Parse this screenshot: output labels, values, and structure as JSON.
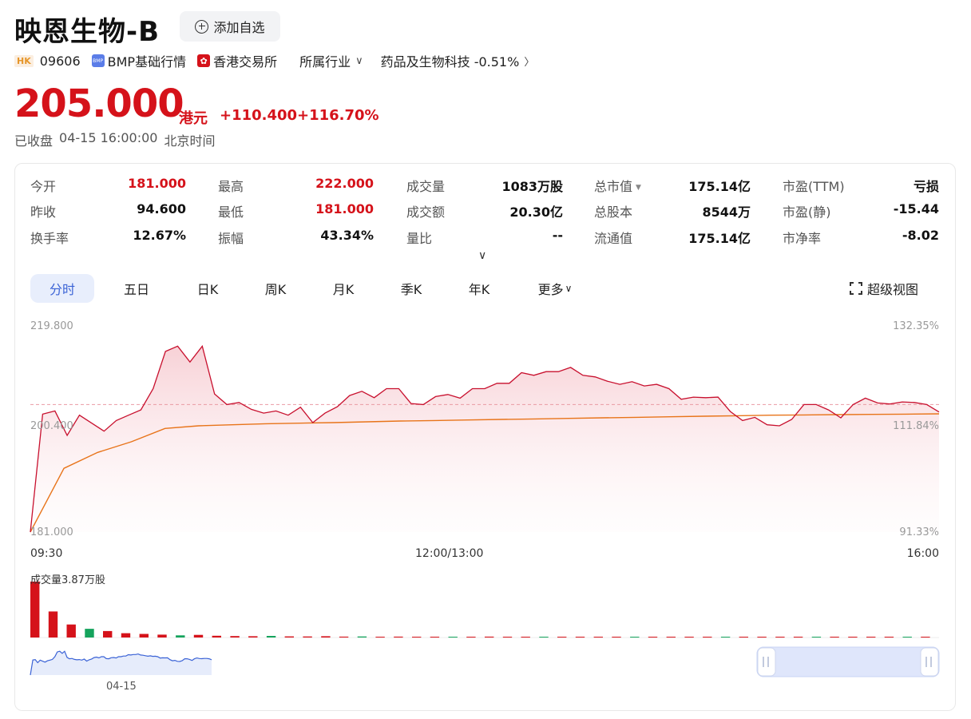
{
  "stock": {
    "name": "映恩生物-B",
    "watch_label": "添加自选",
    "market_badge": "HK",
    "code": "09606",
    "bmp_badge": "BMP",
    "bmp_label": "BMP基础行情",
    "exchange_label": "香港交易所",
    "industry_label": "所属行业",
    "sector_label": "药品及生物科技 -0.51%"
  },
  "quote": {
    "price": "205.000",
    "currency": "港元",
    "change": "+110.400",
    "change_pct": "+116.70%",
    "status": "已收盘",
    "time": "04-15 16:00:00",
    "tz": "北京时间"
  },
  "stats": [
    [
      {
        "label": "今开",
        "value": "181.000",
        "red": true
      },
      {
        "label": "最高",
        "value": "222.000",
        "red": true
      },
      {
        "label": "成交量",
        "value": "1083万股"
      },
      {
        "label": "总市值",
        "value": "175.14亿",
        "caret": true
      },
      {
        "label": "市盈(TTM)",
        "value": "亏损"
      }
    ],
    [
      {
        "label": "昨收",
        "value": "94.600"
      },
      {
        "label": "最低",
        "value": "181.000",
        "red": true
      },
      {
        "label": "成交额",
        "value": "20.30亿"
      },
      {
        "label": "总股本",
        "value": "8544万"
      },
      {
        "label": "市盈(静)",
        "value": "-15.44"
      }
    ],
    [
      {
        "label": "换手率",
        "value": "12.67%"
      },
      {
        "label": "振幅",
        "value": "43.34%"
      },
      {
        "label": "量比",
        "value": "--"
      },
      {
        "label": "流通值",
        "value": "175.14亿"
      },
      {
        "label": "市净率",
        "value": "-8.02"
      }
    ]
  ],
  "tabs": [
    "分时",
    "五日",
    "日K",
    "周K",
    "月K",
    "季K",
    "年K",
    "更多"
  ],
  "superview_label": "超级视图",
  "chart_data": {
    "type": "line",
    "series": [
      {
        "name": "price",
        "values": [
          181.0,
          203.2,
          203.8,
          199.2,
          203.0,
          201.5,
          200.0,
          202.0,
          203.0,
          204.0,
          208.0,
          215.0,
          216.0,
          213.0,
          216.0,
          207.0,
          205.0,
          205.4,
          204.1,
          203.4,
          203.8,
          203.0,
          204.5,
          201.6,
          203.4,
          204.6,
          206.7,
          207.5,
          206.3,
          208.0,
          208.0,
          205.2,
          205.0,
          206.5,
          206.9,
          206.2,
          208.0,
          208.0,
          209.0,
          209.0,
          211.0,
          210.5,
          211.2,
          211.2,
          212.0,
          210.5,
          210.2,
          209.4,
          208.8,
          209.3,
          208.5,
          208.8,
          208.0,
          206.0,
          206.4,
          206.3,
          206.4,
          203.7,
          202.0,
          202.6,
          201.2,
          201.0,
          202.2,
          205.0,
          205.0,
          204.0,
          202.5,
          205.0,
          206.2,
          205.3,
          205.1,
          205.5,
          205.4,
          205.0,
          203.6
        ]
      },
      {
        "name": "avg",
        "values": [
          181.0,
          193.0,
          196.0,
          198.0,
          200.5,
          201.0,
          201.2,
          201.4,
          201.5,
          201.6,
          201.75,
          201.9,
          202.0,
          202.1,
          202.2,
          202.3,
          202.4,
          202.5,
          202.6,
          202.7,
          202.8,
          202.9,
          203.0,
          203.05,
          203.1,
          203.15,
          203.2,
          203.25
        ]
      }
    ],
    "prev_close_line": 205.0,
    "ylim": [
      181.0,
      219.8
    ],
    "y_ticks_left": [
      "219.800",
      "200.400",
      "181.000"
    ],
    "y_ticks_right": [
      "132.35%",
      "111.84%",
      "91.33%"
    ],
    "x_ticks": [
      "09:30",
      "12:00/13:00",
      "16:00"
    ],
    "volume_label": "成交量3.87万股",
    "volume": [
      38700,
      18000,
      9000,
      6000,
      4500,
      3000,
      2500,
      2000,
      1500,
      1800,
      1200,
      1000,
      900,
      1100,
      800,
      700,
      900,
      600,
      700,
      500,
      600,
      500,
      400,
      500,
      400,
      600,
      300,
      500,
      400,
      300,
      400,
      300,
      500,
      300,
      400,
      300,
      200,
      300,
      400,
      300,
      200,
      300,
      200,
      300,
      200,
      200,
      300,
      200,
      200,
      300
    ],
    "mini_date": "04-15",
    "colors": {
      "price": "#c8102e",
      "avg": "#e8741a",
      "fill": "#fbe3e6",
      "volume_up": "#d5121a",
      "volume_down": "#14a35c",
      "mini": "#3b63d6"
    }
  }
}
